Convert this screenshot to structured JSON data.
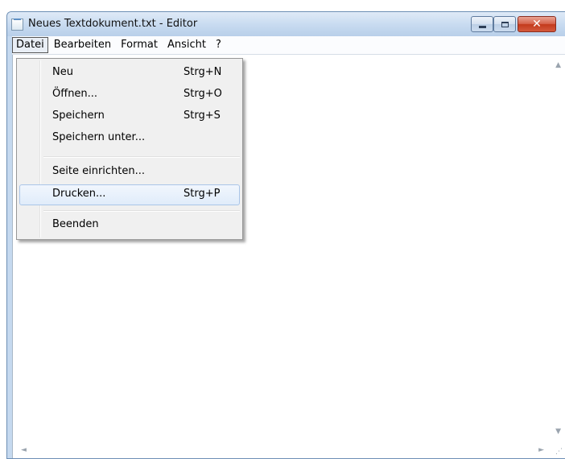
{
  "window": {
    "title": "Neues Textdokument.txt - Editor",
    "controls": {
      "minimize_icon": "minimize-icon",
      "maximize_icon": "maximize-icon",
      "close_icon": "close-icon",
      "close_glyph": "✕",
      "close_color": "#c33a1c"
    }
  },
  "menubar": {
    "items": [
      {
        "label": "Datei",
        "active": true
      },
      {
        "label": "Bearbeiten"
      },
      {
        "label": "Format"
      },
      {
        "label": "Ansicht"
      },
      {
        "label": "?"
      }
    ]
  },
  "file_menu": {
    "items": [
      {
        "label": "Neu",
        "shortcut": "Strg+N"
      },
      {
        "label": "Öffnen...",
        "shortcut": "Strg+O"
      },
      {
        "label": "Speichern",
        "shortcut": "Strg+S"
      },
      {
        "label": "Speichern unter...",
        "shortcut": ""
      },
      {
        "label": "Seite einrichten...",
        "shortcut": ""
      },
      {
        "label": "Drucken...",
        "shortcut": "Strg+P",
        "highlighted": true
      },
      {
        "label": "Beenden",
        "shortcut": ""
      }
    ]
  },
  "scrollbars": {
    "up": "▲",
    "down": "▼",
    "left": "◄",
    "right": "►",
    "grip": "⋰"
  },
  "editor": {
    "content": ""
  }
}
